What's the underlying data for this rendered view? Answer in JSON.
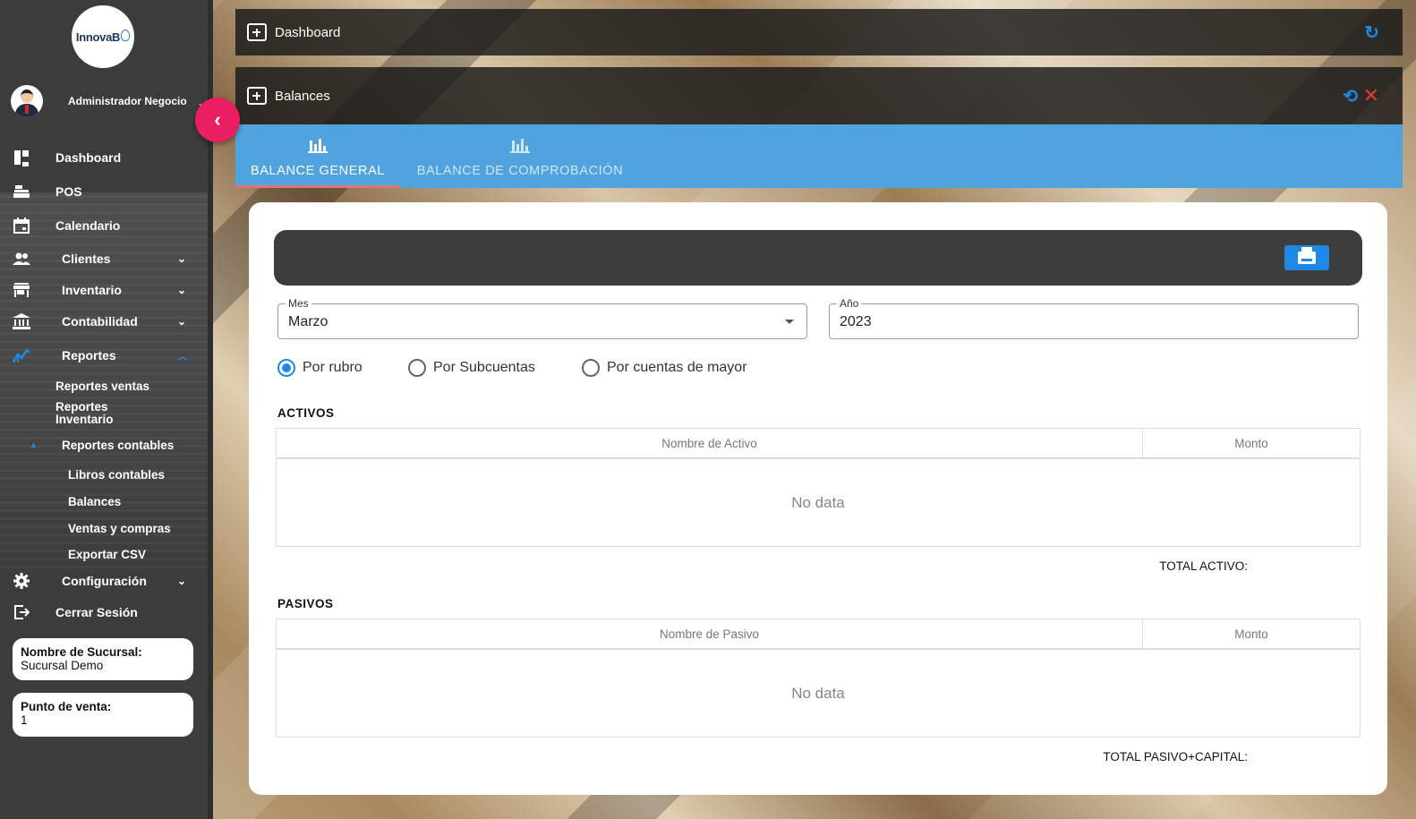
{
  "sidebar": {
    "logo_text": "InnovaB",
    "user_name": "Administrador Negocio",
    "items": [
      {
        "label": "Dashboard"
      },
      {
        "label": "POS"
      },
      {
        "label": "Calendario"
      },
      {
        "label": "Clientes"
      },
      {
        "label": "Inventario"
      },
      {
        "label": "Contabilidad"
      },
      {
        "label": "Reportes"
      },
      {
        "label": "Configuración"
      },
      {
        "label": "Cerrar Sesión"
      }
    ],
    "reportes_sub": [
      "Reportes ventas",
      "Reportes Inventario",
      "Reportes contables"
    ],
    "contables_sub": [
      "Libros contables",
      "Balances",
      "Ventas y compras",
      "Exportar CSV"
    ],
    "branch_card": {
      "label": "Nombre de Sucursal:",
      "value": "Sucursal Demo"
    },
    "pos_card": {
      "label": "Punto de venta:",
      "value": "1"
    }
  },
  "header": {
    "title": "Dashboard"
  },
  "panel": {
    "title": "Balances"
  },
  "tabs": [
    {
      "label": "BALANCE GENERAL",
      "active": true
    },
    {
      "label": "BALANCE DE COMPROBACIÓN",
      "active": false
    }
  ],
  "filters": {
    "mes": {
      "label": "Mes",
      "value": "Marzo"
    },
    "anio": {
      "label": "Año",
      "value": "2023"
    }
  },
  "radios": [
    {
      "label": "Por rubro",
      "checked": true
    },
    {
      "label": "Por Subcuentas",
      "checked": false
    },
    {
      "label": "Por cuentas de mayor",
      "checked": false
    }
  ],
  "activos": {
    "title": "ACTIVOS",
    "col1": "Nombre de Activo",
    "col2": "Monto",
    "empty": "No data",
    "total_label": "TOTAL ACTIVO:"
  },
  "pasivos": {
    "title": "PASIVOS",
    "col1": "Nombre de Pasivo",
    "col2": "Monto",
    "empty": "No data",
    "total_label": "TOTAL PASIVO+CAPITAL:"
  },
  "colors": {
    "accent": "#1e88e5",
    "tab_bar": "#4fa3de",
    "collapse": "#e91e63",
    "close": "#e53935"
  }
}
